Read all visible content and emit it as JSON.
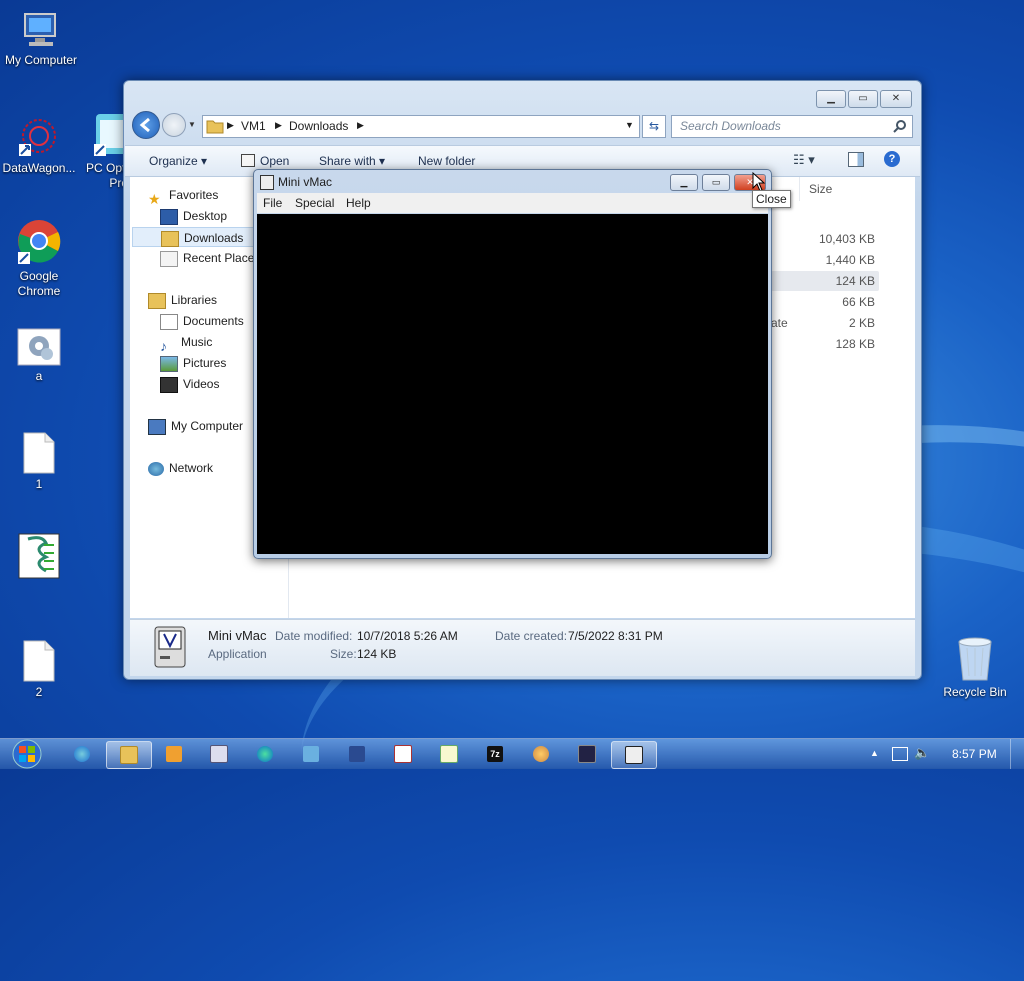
{
  "desktop": {
    "icons": [
      {
        "label": "My Computer"
      },
      {
        "label": "DataWagon..."
      },
      {
        "label": "PC Opti Pro"
      },
      {
        "label": "Google Chrome"
      },
      {
        "label": "a"
      },
      {
        "label": "1"
      },
      {
        "label": "2"
      },
      {
        "label": "Recycle Bin"
      }
    ]
  },
  "explorer": {
    "breadcrumb": [
      "VM1",
      "Downloads"
    ],
    "search_placeholder": "Search Downloads",
    "toolbar": {
      "organize": "Organize",
      "open": "Open",
      "share_with": "Share with",
      "new_folder": "New folder"
    },
    "nav": {
      "favorites": "Favorites",
      "desktop": "Desktop",
      "downloads": "Downloads",
      "recent": "Recent Places",
      "libraries": "Libraries",
      "documents": "Documents",
      "music": "Music",
      "pictures": "Pictures",
      "videos": "Videos",
      "my_computer": "My Computer",
      "network": "Network"
    },
    "columns": {
      "size": "Size",
      "partial": "ate"
    },
    "sizes": [
      "10,403 KB",
      "1,440 KB",
      "124 KB",
      "66 KB",
      "2 KB",
      "128 KB"
    ],
    "details": {
      "name": "Mini vMac",
      "type": "Application",
      "date_modified_label": "Date modified:",
      "date_modified": "10/7/2018 5:26 AM",
      "date_created_label": "Date created:",
      "date_created": "7/5/2022 8:31 PM",
      "size_label": "Size:",
      "size": "124 KB"
    }
  },
  "minivmac": {
    "title": "Mini vMac",
    "menu": [
      "File",
      "Special",
      "Help"
    ],
    "tooltip": "Close"
  },
  "taskbar": {
    "clock": "8:57 PM"
  }
}
